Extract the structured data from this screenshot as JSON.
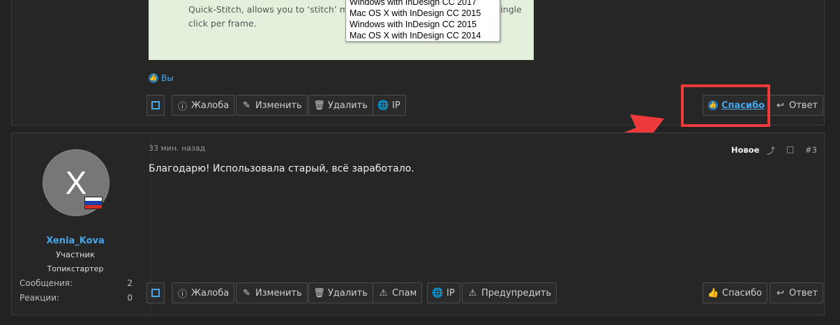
{
  "quote": {
    "text": "Quick-Stitch, allows you to ‘stitch’ mu                                    single click per frame.",
    "text_line1_left": "Quick-Stitch, allows you to ‘stitch’ mu",
    "text_line1_right": "single",
    "text_line2": "click per frame."
  },
  "popup": {
    "options": [
      "Windows with InDesign CC 2017",
      "Mac OS X with InDesign CC 2015",
      "Windows with InDesign CC 2015",
      "Mac OS X with InDesign CC 2014"
    ]
  },
  "post1": {
    "reactions_text": "Вы",
    "actions": {
      "report": "Жалоба",
      "edit": "Изменить",
      "delete": "Удалить",
      "ip": "IP",
      "thanks": "Спасибо",
      "reply": "Ответ"
    }
  },
  "post2": {
    "avatar_letter": "X",
    "username": "Xenia_Kova",
    "role": "Участник",
    "starter_label": "Топикстартер",
    "stats": [
      {
        "label": "Сообщения:",
        "value": "2"
      },
      {
        "label": "Реакции:",
        "value": "0"
      }
    ],
    "time": "33 мин. назад",
    "new_label": "Новое",
    "post_number": "#3",
    "body": "Благодарю! Использовала старый, всё заработало.",
    "actions": {
      "report": "Жалоба",
      "edit": "Изменить",
      "delete": "Удалить",
      "spam": "Спам",
      "ip": "IP",
      "warn": "Предупредить",
      "thanks": "Спасибо",
      "reply": "Ответ"
    }
  },
  "colors": {
    "accent": "#47a7eb",
    "annotation": "#ee3a3a",
    "background": "#222222"
  }
}
